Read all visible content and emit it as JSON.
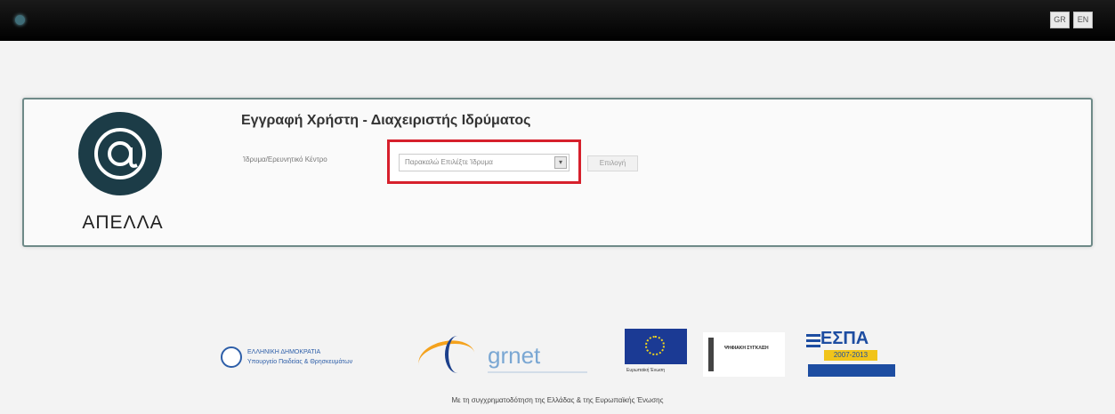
{
  "header": {
    "lang_gr": "GR",
    "lang_en": "EN"
  },
  "app": {
    "logo_text": "ΑΠΕΛΛΑ"
  },
  "form": {
    "title": "Εγγραφή Χρήστη - Διαχειριστής Ιδρύματος",
    "field_label": "Ίδρυμα/Ερευνητικό Κέντρο",
    "select_value": "Παρακαλώ Επιλέξτε Ίδρυμα",
    "select_button": "Επιλογή"
  },
  "footer": {
    "ministry_line1": "ΕΛΛΗΝΙΚΗ ΔΗΜΟΚΡΑΤΙΑ",
    "ministry_line2": "Υπουργείο Παιδείας & Θρησκευμάτων",
    "grnet": "grnet",
    "eu_caption": "Ευρωπαϊκή Ένωση",
    "digital": "ΨΗΦΙΑΚΗ ΣΥΓΚΛΙΣΗ",
    "espa": "ΕΣΠΑ",
    "espa_years": "2007-2013",
    "cofund_text": "Με τη συγχρηματοδότηση της Ελλάδας & της Ευρωπαϊκής Ένωσης"
  },
  "colors": {
    "highlight_border": "#d6202c",
    "panel_border": "#6e8a88",
    "logo_bg": "#1c3c47"
  }
}
